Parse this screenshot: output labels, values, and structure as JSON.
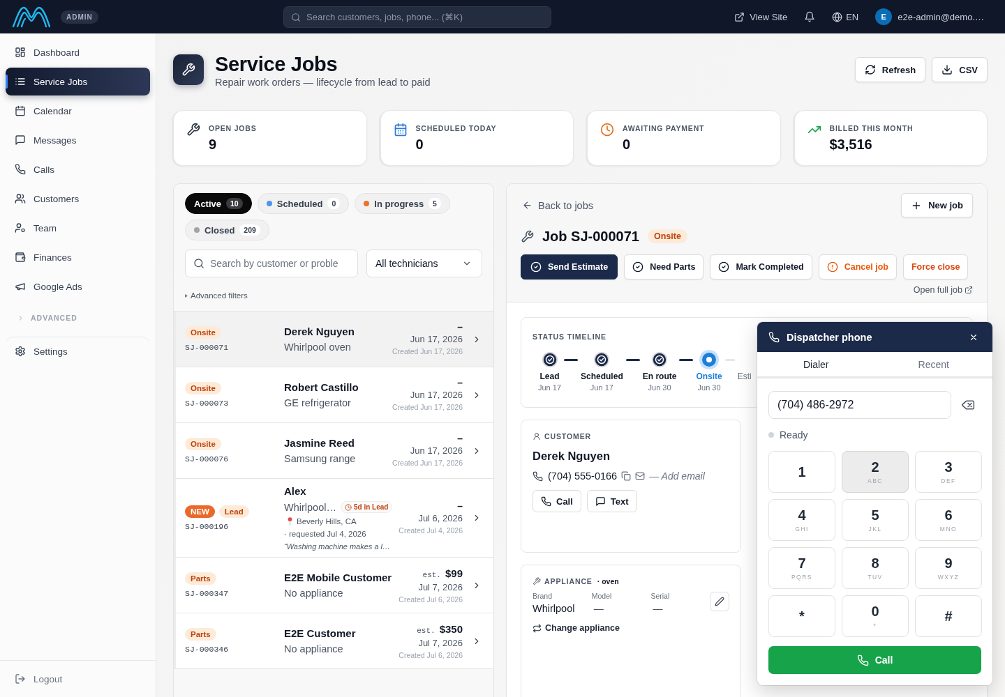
{
  "topbar": {
    "badge": "ADMIN",
    "search": {
      "placeholder": "Search customers, jobs, phone... (⌘K)"
    },
    "view_site": "View Site",
    "language": "EN",
    "user": {
      "initial": "E",
      "email": "e2e-admin@demo.…"
    }
  },
  "sidebar": {
    "items": [
      {
        "label": "Dashboard",
        "selected": false
      },
      {
        "label": "Service Jobs",
        "selected": true
      },
      {
        "label": "Calendar",
        "selected": false
      },
      {
        "label": "Messages",
        "selected": false
      },
      {
        "label": "Calls",
        "selected": false
      },
      {
        "label": "Customers",
        "selected": false
      },
      {
        "label": "Team",
        "selected": false
      },
      {
        "label": "Finances",
        "selected": false
      },
      {
        "label": "Google Ads",
        "selected": false
      }
    ],
    "section": {
      "label": "ADVANCED",
      "expanded": false
    },
    "bottom_items": [
      {
        "label": "Settings",
        "selected": false
      }
    ],
    "logout": "Logout"
  },
  "page": {
    "title": "Service Jobs",
    "subtitle": "Repair work orders — lifecycle from lead to paid",
    "buttons": [
      "Refresh",
      "CSV"
    ]
  },
  "stats": [
    {
      "label": "OPEN JOBS",
      "value": "9"
    },
    {
      "label": "SCHEDULED TODAY",
      "value": "0"
    },
    {
      "label": "AWAITING PAYMENT",
      "value": "0"
    },
    {
      "label": "BILLED THIS MONTH",
      "value": "$3,516"
    }
  ],
  "jobs_panel": {
    "filters": [
      {
        "label": "Active",
        "count": "10",
        "selected": true
      },
      {
        "label": "Scheduled",
        "count": "0",
        "selected": false,
        "color": "#4f95ea"
      },
      {
        "label": "In progress",
        "count": "5",
        "selected": false,
        "color": "#e8732c"
      },
      {
        "label": "Closed",
        "count": "209",
        "selected": false,
        "color": "#a3a3a3"
      }
    ],
    "search": {
      "placeholder": "Search by customer or proble"
    },
    "technician_select": "All technicians",
    "advanced_filters": {
      "label": "Advanced filters",
      "expanded": false
    },
    "rows": [
      {
        "badges": [
          {
            "text": "Onsite",
            "kind": "status"
          }
        ],
        "id": "SJ-000071",
        "name": "Derek Nguyen",
        "subtitle": "Whirlpool oven",
        "amount": "–",
        "date": "Jun 17, 2026",
        "created": "Created Jun 17, 2026",
        "selected": true
      },
      {
        "badges": [
          {
            "text": "Onsite",
            "kind": "status"
          }
        ],
        "id": "SJ-000073",
        "name": "Robert Castillo",
        "subtitle": "GE refrigerator",
        "amount": "–",
        "date": "Jun 17, 2026",
        "created": "Created Jun 17, 2026",
        "selected": false
      },
      {
        "badges": [
          {
            "text": "Onsite",
            "kind": "status"
          }
        ],
        "id": "SJ-000076",
        "name": "Jasmine Reed",
        "subtitle": "Samsung range",
        "amount": "–",
        "date": "Jun 17, 2026",
        "created": "Created Jun 17, 2026",
        "selected": false
      },
      {
        "badges": [
          {
            "text": "NEW",
            "kind": "new"
          },
          {
            "text": "Lead",
            "kind": "status"
          }
        ],
        "id": "SJ-000196",
        "name": "Alex",
        "subtitle": "Whirlpool…",
        "tag": "5d in Lead",
        "location": "Beverly Hills, CA",
        "requested": "· requested Jul 4, 2026",
        "note": "“Washing machine makes a l…",
        "amount": "–",
        "date": "Jul 6, 2026",
        "created": "Created Jul 4, 2026",
        "selected": false
      },
      {
        "badges": [
          {
            "text": "Parts",
            "kind": "status"
          }
        ],
        "id": "SJ-000347",
        "name": "E2E Mobile Customer",
        "subtitle": "No appliance",
        "estimate": {
          "prefix": "est.",
          "value": "$99"
        },
        "date": "Jul 7, 2026",
        "created": "Created Jul 6, 2026",
        "selected": false
      },
      {
        "badges": [
          {
            "text": "Parts",
            "kind": "status"
          }
        ],
        "id": "SJ-000346",
        "name": "E2E Customer",
        "subtitle": "No appliance",
        "estimate": {
          "prefix": "est.",
          "value": "$350"
        },
        "date": "Jul 7, 2026",
        "created": "Created Jul 6, 2026",
        "selected": false
      }
    ]
  },
  "detail": {
    "back": "Back to jobs",
    "new_job": "New job",
    "title": "Job SJ-000071",
    "status": "Onsite",
    "actions": [
      {
        "label": "Send Estimate",
        "kind": "primary"
      },
      {
        "label": "Need Parts",
        "kind": "secondary"
      },
      {
        "label": "Mark Completed",
        "kind": "secondary"
      },
      {
        "label": "Cancel job",
        "kind": "warning"
      },
      {
        "label": "Force close",
        "kind": "danger"
      }
    ],
    "open_full": "Open full job",
    "timeline": {
      "title": "STATUS TIMELINE",
      "steps": [
        {
          "label": "Lead",
          "date": "Jun 17",
          "kind": "done"
        },
        {
          "label": "Scheduled",
          "date": "Jun 17",
          "kind": "done"
        },
        {
          "label": "En route",
          "date": "Jun 30",
          "kind": "done"
        },
        {
          "label": "Onsite",
          "date": "Jun 30",
          "kind": "current"
        },
        {
          "label": "Esti",
          "kind": "pending"
        }
      ]
    },
    "customer": {
      "heading": "CUSTOMER",
      "name": "Derek Nguyen",
      "phone": "(704) 555-0166",
      "email_placeholder": "— Add email",
      "buttons": [
        "Call",
        "Text"
      ]
    },
    "appliance": {
      "heading": "APPLIANCE",
      "type": "· oven",
      "fields": [
        {
          "label": "Brand",
          "value": "Whirlpool"
        },
        {
          "label": "Model",
          "value": "—"
        },
        {
          "label": "Serial",
          "value": "—"
        }
      ],
      "change": "Change appliance"
    }
  },
  "dialer": {
    "title": "Dispatcher phone",
    "tabs": [
      {
        "label": "Dialer",
        "selected": true
      },
      {
        "label": "Recent",
        "selected": false
      }
    ],
    "number": "(704) 486-2972",
    "status": "Ready",
    "keys": [
      {
        "digit": "1",
        "hovered": false
      },
      {
        "digit": "2",
        "letters": "ABC",
        "hovered": true
      },
      {
        "digit": "3",
        "letters": "DEF",
        "hovered": false
      },
      {
        "digit": "4",
        "letters": "GHI",
        "hovered": false
      },
      {
        "digit": "5",
        "letters": "JKL",
        "hovered": false
      },
      {
        "digit": "6",
        "letters": "MNO",
        "hovered": false
      },
      {
        "digit": "7",
        "letters": "PQRS",
        "hovered": false
      },
      {
        "digit": "8",
        "letters": "TUV",
        "hovered": false
      },
      {
        "digit": "9",
        "letters": "WXYZ",
        "hovered": false
      },
      {
        "digit": "*",
        "hovered": false
      },
      {
        "digit": "0",
        "letters": "+",
        "hovered": false
      },
      {
        "digit": "#",
        "hovered": false
      }
    ],
    "call": "Call"
  }
}
